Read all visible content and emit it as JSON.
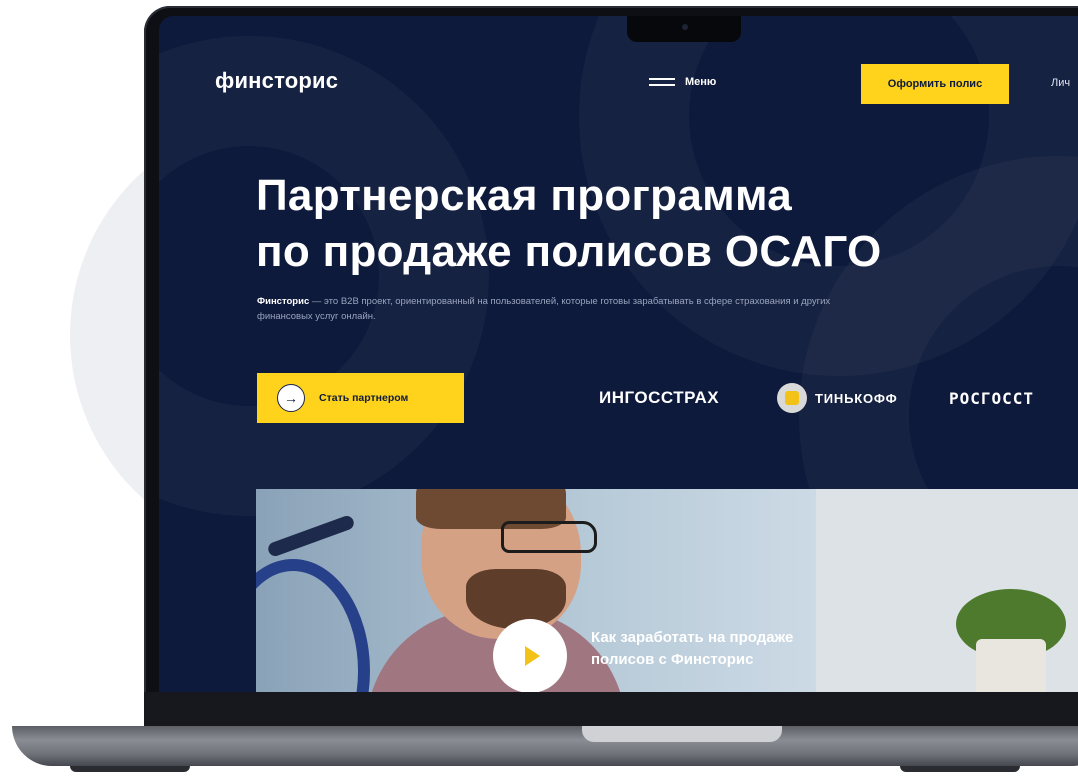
{
  "header": {
    "logo": "финсторис",
    "menu_label": "Меню",
    "cta_label": "Оформить полис",
    "cabinet_label": "Лич"
  },
  "hero": {
    "title_line1": "Партнерская программа",
    "title_line2": "по продаже полисов ОСАГО",
    "desc_brand": "Финсторис",
    "desc_text": " — это B2B проект, ориентированный на пользователей, которые готовы зарабатывать в сфере страхования и других финансовых услуг онлайн.",
    "partner_button": "Стать партнером",
    "arrow_glyph": "→"
  },
  "partners": [
    {
      "name": "ИНГОССТРАХ"
    },
    {
      "name": "ТИНЬКОФФ"
    },
    {
      "name": "РОСГОССТ"
    }
  ],
  "video": {
    "caption_line1": "Как заработать на продаже",
    "caption_line2": "полисов с Финсторис"
  },
  "colors": {
    "background": "#0e1a3b",
    "accent": "#ffd31b",
    "text": "#ffffff"
  },
  "icons": [
    "menu-icon",
    "arrow-right-icon",
    "play-icon",
    "tinkoff-emblem-icon"
  ]
}
